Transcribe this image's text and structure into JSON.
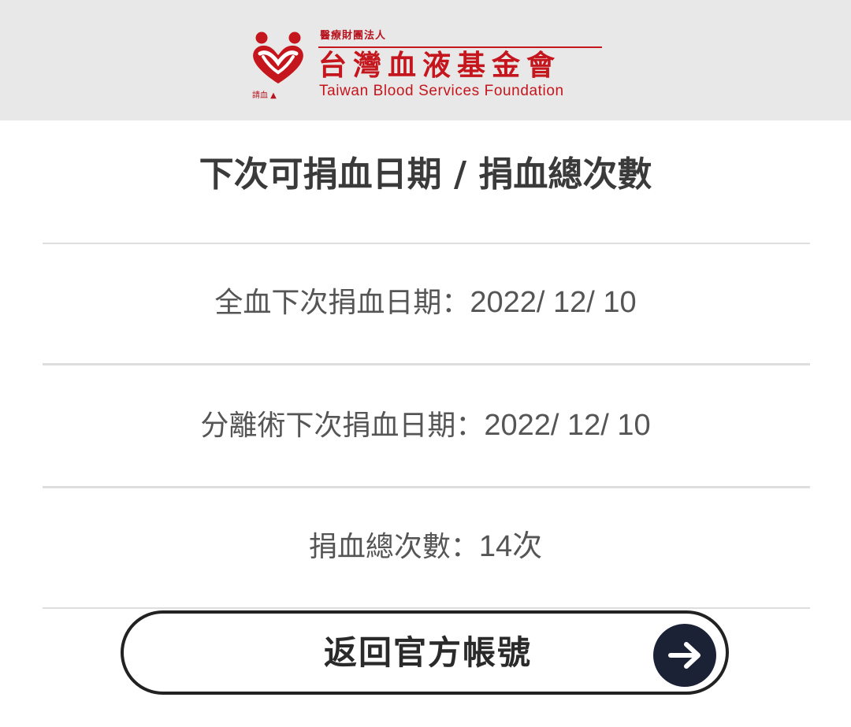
{
  "header": {
    "logo": {
      "org_prefix": "醫療財團法人",
      "name_cn": "台灣血液基金會",
      "name_en": "Taiwan Blood Services Foundation",
      "tiny_mark": "請血 ▲",
      "icon": "blood-donation-heart-logo",
      "brand_color": "#c4161c"
    },
    "background_color": "#e8e8e8"
  },
  "main": {
    "title": "下次可捐血日期 / 捐血總次數",
    "rows": [
      {
        "label": "全血下次捐血日期：",
        "value": "2022/ 12/ 10"
      },
      {
        "label": "分離術下次捐血日期：",
        "value": "2022/ 12/ 10"
      },
      {
        "label": "捐血總次數：",
        "value": "14次"
      }
    ]
  },
  "back_button": {
    "label": "返回官方帳號",
    "icon": "arrow-right-icon",
    "icon_bg_color": "#1c2236"
  }
}
